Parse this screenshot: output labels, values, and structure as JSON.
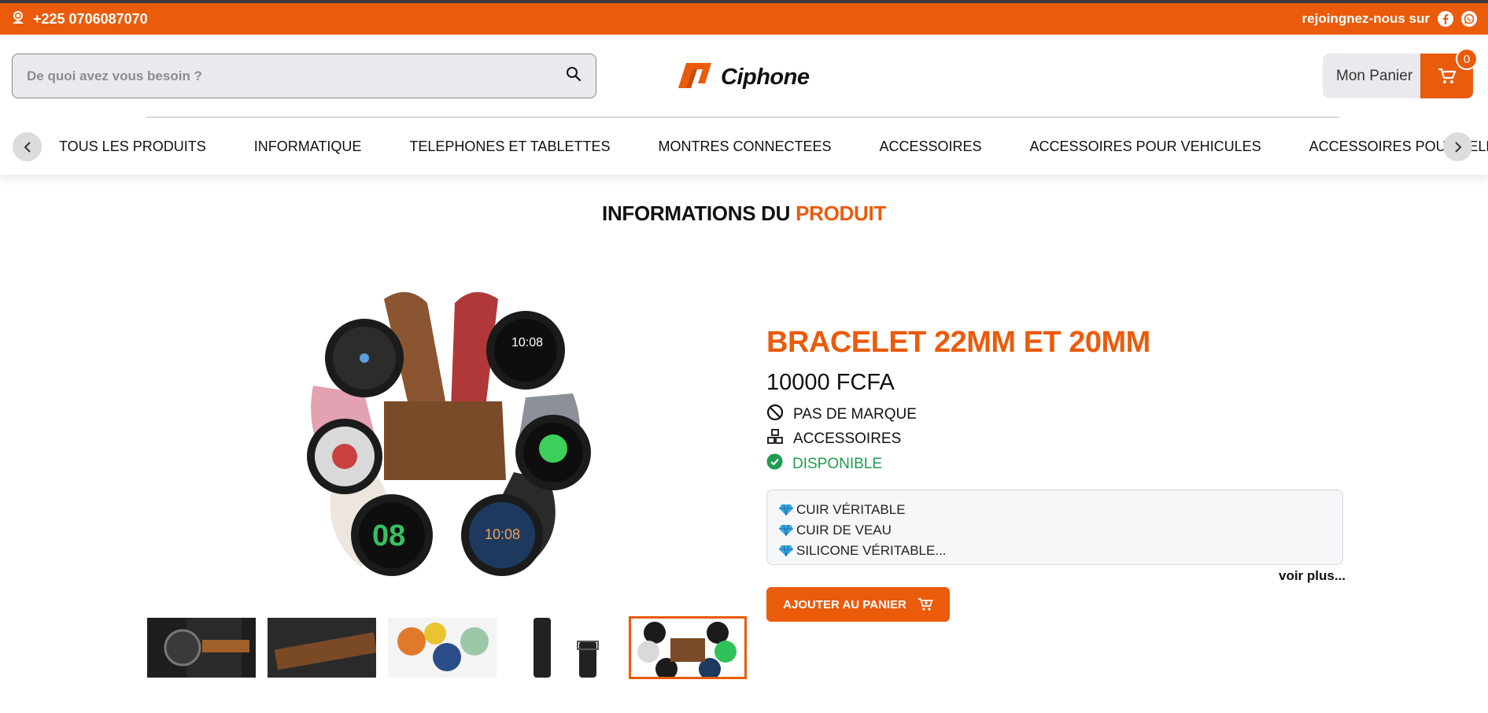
{
  "topbar": {
    "phone": "+225 0706087070",
    "social_label": "rejoingnez-nous sur",
    "social_icons": [
      "facebook-icon",
      "whatsapp-icon"
    ]
  },
  "header": {
    "search_placeholder": "De quoi avez vous besoin ?",
    "logo_text": "Ciphone",
    "cart_label": "Mon Panier",
    "cart_count": "0"
  },
  "categories": [
    "TOUS LES PRODUITS",
    "INFORMATIQUE",
    "TELEPHONES ET TABLETTES",
    "MONTRES CONNECTEES",
    "ACCESSOIRES",
    "ACCESSOIRES POUR VEHICULES",
    "ACCESSOIRES POUR TELEPHONES"
  ],
  "page_title": {
    "part1": "INFORMATIONS DU",
    "part2": "PRODUIT"
  },
  "product": {
    "name": "BRACELET 22MM ET 20MM",
    "price": "10000 FCFA",
    "brand": "PAS DE MARQUE",
    "category": "ACCESSOIRES",
    "availability": "DISPONIBLE",
    "features": [
      "CUIR VÉRITABLE",
      "CUIR DE VEAU",
      "SILICONE VÉRITABLE..."
    ],
    "more_label": "voir plus...",
    "add_to_cart_label": "AJOUTER AU PANIER"
  },
  "colors": {
    "accent": "#ea5b0c",
    "success": "#1e9c4f"
  }
}
